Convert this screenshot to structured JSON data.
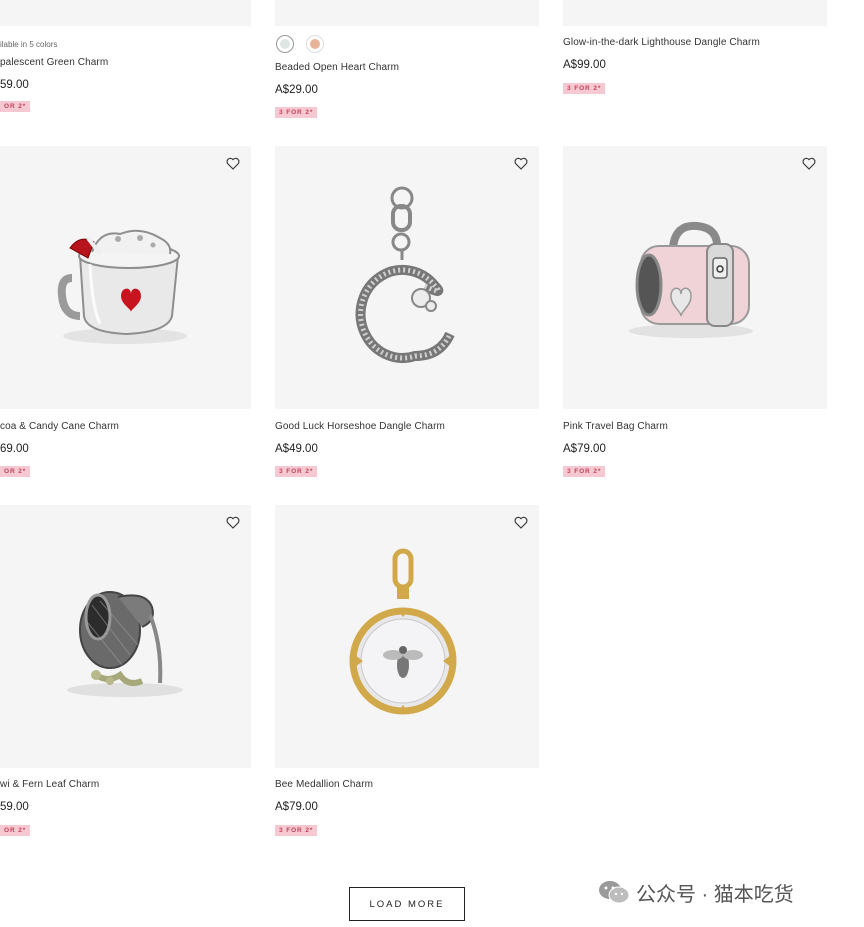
{
  "products": {
    "row1": [
      {
        "colors_note": "ilable in 5 colors",
        "name": "palescent Green Charm",
        "price": "59.00",
        "badge": "OR 2*"
      },
      {
        "name": "Beaded Open Heart Charm",
        "price": "A$29.00",
        "badge": "3 FOR 2*"
      },
      {
        "name": "Glow-in-the-dark Lighthouse Dangle Charm",
        "price": "A$99.00",
        "badge": "3 FOR 2*"
      }
    ],
    "row2": [
      {
        "name": "coa & Candy Cane Charm",
        "price": "69.00",
        "badge": "OR 2*"
      },
      {
        "name": "Good Luck Horseshoe Dangle Charm",
        "price": "A$49.00",
        "badge": "3 FOR 2*"
      },
      {
        "name": "Pink Travel Bag Charm",
        "price": "A$79.00",
        "badge": "3 FOR 2*"
      }
    ],
    "row3": [
      {
        "name": "wi & Fern Leaf Charm",
        "price": "59.00",
        "badge": "OR 2*"
      },
      {
        "name": "Bee Medallion Charm",
        "price": "A$79.00",
        "badge": "3 FOR 2*"
      }
    ]
  },
  "swatches": [
    {
      "color": "#dfe6e4",
      "label": "silver"
    },
    {
      "color": "#e7b49a",
      "label": "rose"
    }
  ],
  "load_more_label": "LOAD MORE",
  "watermark": {
    "text": "公众号 · 猫本吃货",
    "icon": "wechat-icon"
  },
  "colors": {
    "badge_bg": "#f6c9d2",
    "badge_text": "#c0435a",
    "card_bg": "#f5f5f5"
  }
}
